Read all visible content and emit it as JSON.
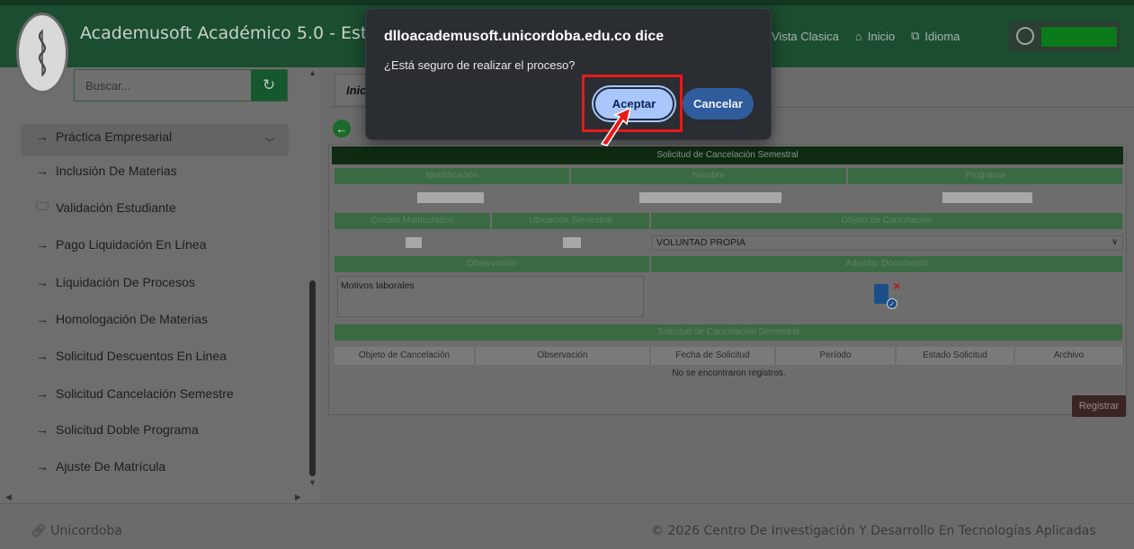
{
  "header": {
    "app_title": "Academusoft Académico 5.0 - Estu",
    "links": [
      {
        "label": "Vista Clasica",
        "icon": "monitor-icon"
      },
      {
        "label": "Inicio",
        "icon": "home-icon"
      },
      {
        "label": "Idioma",
        "icon": "translate-icon"
      }
    ],
    "user_icon": "user-circle-icon"
  },
  "sidebar": {
    "search_placeholder": "Buscar...",
    "refresh_icon": "refresh-icon",
    "items": [
      {
        "label": "Práctica Empresarial",
        "icon": "arrow-right-icon"
      },
      {
        "label": "Inclusión De Materias",
        "icon": "arrow-right-icon"
      },
      {
        "label": "Validación Estudiante",
        "icon": "folder-icon"
      },
      {
        "label": "Pago Liquidación En Línea",
        "icon": "arrow-right-icon"
      },
      {
        "label": "Liquidación De Procesos",
        "icon": "arrow-right-icon"
      },
      {
        "label": "Homologación De Materias",
        "icon": "arrow-right-icon"
      },
      {
        "label": "Solicitud Descuentos En Linea",
        "icon": "arrow-right-icon"
      },
      {
        "label": "Solicitud Cancelación Semestre",
        "icon": "arrow-right-icon"
      },
      {
        "label": "Solicitud Doble Programa",
        "icon": "arrow-right-icon"
      },
      {
        "label": "Ajuste De Matrícula",
        "icon": "arrow-right-icon"
      }
    ]
  },
  "main": {
    "tab_label": "Inic",
    "form": {
      "title": "Solicitud de Cancelación Semestral",
      "col_identificacion": "Identificación",
      "col_nombre": "Nombre",
      "col_programa": "Programa",
      "col_creditos": "Credito Matriculados",
      "col_ubicacion": "Ubicación Semestral",
      "col_objeto": "Objeto de Cancelación",
      "objeto_value": "VOLUNTAD PROPIA",
      "col_observacion": "Observación",
      "col_adjuntar": "Adjuntar Documento",
      "observacion_value": "Motivos laborales"
    },
    "history": {
      "title": "Solicitud de Cancelación Semestral",
      "columns": [
        "Objeto de Cancelación",
        "Observación",
        "Fecha de Solicitud",
        "Período",
        "Estado Solicitud",
        "Archivo"
      ],
      "empty_message": "No se encontraron registros."
    },
    "register_button": "Registrar"
  },
  "footer": {
    "left": "Unicordoba",
    "right": "© 2026 Centro De Investigación Y Desarrollo En Tecnologías Aplicadas"
  },
  "dialog": {
    "title": "dlloacademusoft.unicordoba.edu.co dice",
    "message": "¿Está seguro de realizar el proceso?",
    "ok_label": "Aceptar",
    "cancel_label": "Cancelar"
  },
  "colors": {
    "brand_green": "#1b4d30",
    "highlight_red": "#e81919",
    "dialog_ok": "#a9c7fa",
    "dialog_cancel": "#2f5c9c"
  }
}
